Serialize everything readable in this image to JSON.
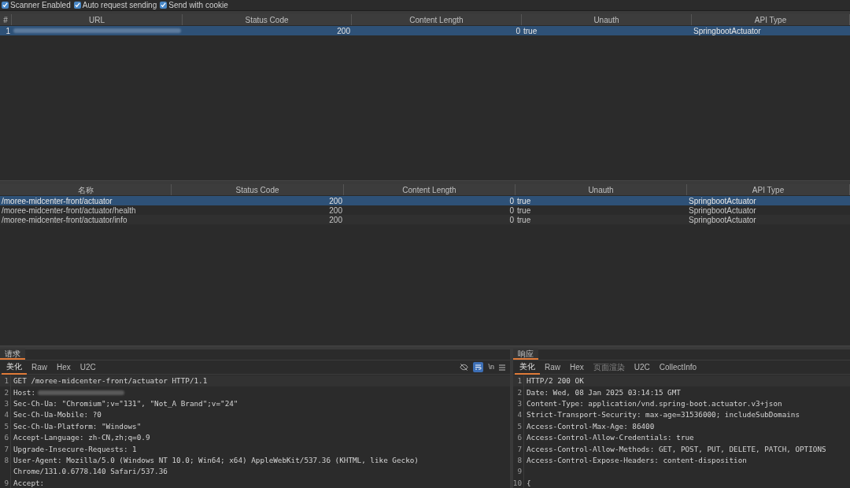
{
  "toolbar": {
    "checkboxes": [
      {
        "label": "Scanner Enabled",
        "checked": true
      },
      {
        "label": "Auto request sending",
        "checked": true
      },
      {
        "label": "Send with cookie",
        "checked": true
      }
    ]
  },
  "scan_table": {
    "columns": [
      "#",
      "URL",
      "Status Code",
      "Content Length",
      "Unauth",
      "API Type"
    ],
    "rows": [
      {
        "number": "1",
        "url_redacted": true,
        "status_code": "200",
        "content_length": "0",
        "unauth": "true",
        "api_type": "SpringbootActuator",
        "selected": true
      }
    ]
  },
  "path_table": {
    "columns": [
      "名称",
      "Status Code",
      "Content Length",
      "Unauth",
      "API Type"
    ],
    "rows": [
      {
        "name": "/moree-midcenter-front/actuator",
        "status_code": "200",
        "content_length": "0",
        "unauth": "true",
        "api_type": "SpringbootActuator",
        "selected": true
      },
      {
        "name": "/moree-midcenter-front/actuator/health",
        "status_code": "200",
        "content_length": "0",
        "unauth": "true",
        "api_type": "SpringbootActuator",
        "selected": false
      },
      {
        "name": "/moree-midcenter-front/actuator/info",
        "status_code": "200",
        "content_length": "0",
        "unauth": "true",
        "api_type": "SpringbootActuator",
        "selected": false
      }
    ]
  },
  "request_panel": {
    "title": "请求",
    "tabs": [
      {
        "label": "美化",
        "selected": true,
        "disabled": false
      },
      {
        "label": "Raw",
        "selected": false,
        "disabled": false
      },
      {
        "label": "Hex",
        "selected": false,
        "disabled": false
      },
      {
        "label": "U2C",
        "selected": false,
        "disabled": false
      }
    ],
    "newline_toggle": "\\n",
    "lines": [
      {
        "number": "1",
        "text": "GET /moree-midcenter-front/actuator HTTP/1.1",
        "redacted": false
      },
      {
        "number": "2",
        "text": "Host:",
        "redacted": true
      },
      {
        "number": "3",
        "text": "Sec-Ch-Ua: \"Chromium\";v=\"131\", \"Not_A Brand\";v=\"24\"",
        "redacted": false
      },
      {
        "number": "4",
        "text": "Sec-Ch-Ua-Mobile: ?0",
        "redacted": false
      },
      {
        "number": "5",
        "text": "Sec-Ch-Ua-Platform: \"Windows\"",
        "redacted": false
      },
      {
        "number": "6",
        "text": "Accept-Language: zh-CN,zh;q=0.9",
        "redacted": false
      },
      {
        "number": "7",
        "text": "Upgrade-Insecure-Requests: 1",
        "redacted": false
      },
      {
        "number": "8",
        "text": "User-Agent: Mozilla/5.0 (Windows NT 10.0; Win64; x64) AppleWebKit/537.36 (KHTML, like Gecko)",
        "redacted": false
      },
      {
        "text": "Chrome/131.0.6778.140 Safari/537.36",
        "redacted": false
      },
      {
        "number": "9",
        "text": "Accept:",
        "redacted": false
      }
    ]
  },
  "response_panel": {
    "title": "响应",
    "tabs": [
      {
        "label": "美化",
        "selected": true,
        "disabled": false
      },
      {
        "label": "Raw",
        "selected": false,
        "disabled": false
      },
      {
        "label": "Hex",
        "selected": false,
        "disabled": false
      },
      {
        "label": "页面渲染",
        "selected": false,
        "disabled": true
      },
      {
        "label": "U2C",
        "selected": false,
        "disabled": false
      },
      {
        "label": "CollectInfo",
        "selected": false,
        "disabled": false
      }
    ],
    "lines": [
      {
        "number": "1",
        "text": "HTTP/2 200 OK",
        "redacted": false
      },
      {
        "number": "2",
        "text": "Date: Wed, 08 Jan 2025 03:14:15 GMT",
        "redacted": false
      },
      {
        "number": "3",
        "text": "Content-Type: application/vnd.spring-boot.actuator.v3+json",
        "redacted": false
      },
      {
        "number": "4",
        "text": "Strict-Transport-Security: max-age=31536000; includeSubDomains",
        "redacted": false
      },
      {
        "number": "5",
        "text": "Access-Control-Max-Age: 86400",
        "redacted": false
      },
      {
        "number": "6",
        "text": "Access-Control-Allow-Credentials: true",
        "redacted": false
      },
      {
        "number": "7",
        "text": "Access-Control-Allow-Methods: GET, POST, PUT, DELETE, PATCH, OPTIONS",
        "redacted": false
      },
      {
        "number": "8",
        "text": "Access-Control-Expose-Headers: content-disposition",
        "redacted": false
      },
      {
        "number": "9",
        "redacted": false
      },
      {
        "number": "10",
        "text": "{",
        "redacted": false
      }
    ]
  }
}
